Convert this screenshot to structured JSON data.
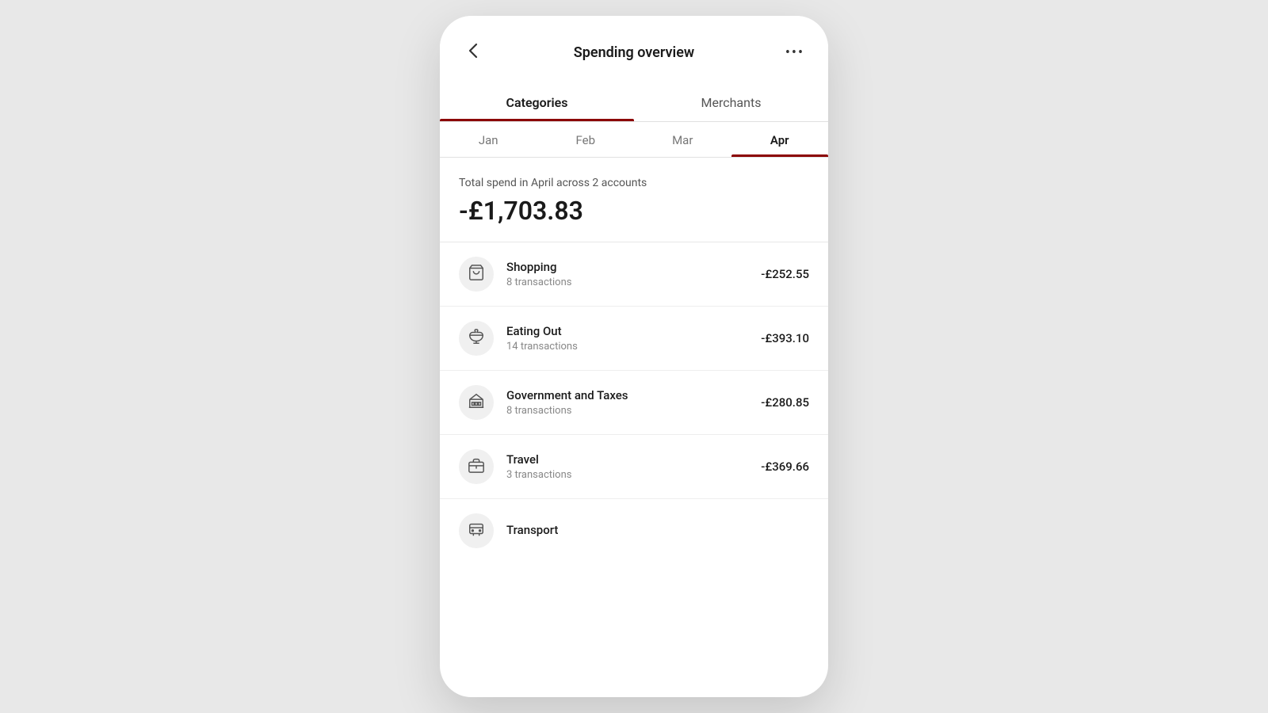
{
  "header": {
    "title": "Spending overview",
    "back_label": "‹",
    "more_label": "•••"
  },
  "main_tabs": [
    {
      "id": "categories",
      "label": "Categories",
      "active": true
    },
    {
      "id": "merchants",
      "label": "Merchants",
      "active": false
    }
  ],
  "month_tabs": [
    {
      "id": "jan",
      "label": "Jan",
      "active": false
    },
    {
      "id": "feb",
      "label": "Feb",
      "active": false
    },
    {
      "id": "mar",
      "label": "Mar",
      "active": false
    },
    {
      "id": "apr",
      "label": "Apr",
      "active": true
    }
  ],
  "summary": {
    "label": "Total spend in April across 2 accounts",
    "amount": "-£1,703.83"
  },
  "categories": [
    {
      "id": "shopping",
      "name": "Shopping",
      "transactions": "8 transactions",
      "amount": "-£252.55",
      "icon": "cart"
    },
    {
      "id": "eating-out",
      "name": "Eating Out",
      "transactions": "14 transactions",
      "amount": "-£393.10",
      "icon": "bowl"
    },
    {
      "id": "government-taxes",
      "name": "Government and Taxes",
      "transactions": "8 transactions",
      "amount": "-£280.85",
      "icon": "government"
    },
    {
      "id": "travel",
      "name": "Travel",
      "transactions": "3 transactions",
      "amount": "-£369.66",
      "icon": "briefcase"
    },
    {
      "id": "transport",
      "name": "Transport",
      "transactions": "",
      "amount": "",
      "icon": "bus"
    }
  ],
  "colors": {
    "accent": "#8b0000",
    "background": "#e8e8e8"
  }
}
